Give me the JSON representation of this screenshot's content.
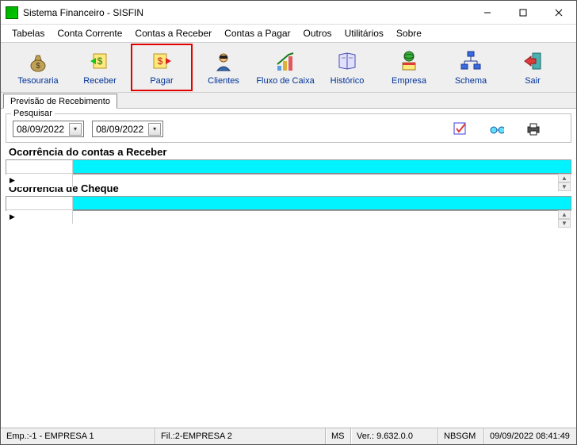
{
  "window": {
    "title": "Sistema Financeiro - SISFIN"
  },
  "menu": [
    "Tabelas",
    "Conta Corrente",
    "Contas a Receber",
    "Contas a Pagar",
    "Outros",
    "Utilitários",
    "Sobre"
  ],
  "toolbar": [
    {
      "label": "Tesouraria",
      "icon": "money-bag-icon",
      "highlight": false
    },
    {
      "label": "Receber",
      "icon": "receive-icon",
      "highlight": false
    },
    {
      "label": "Pagar",
      "icon": "pay-icon",
      "highlight": true
    },
    {
      "label": "Clientes",
      "icon": "client-icon",
      "highlight": false
    },
    {
      "label": "Fluxo de Caixa",
      "icon": "cashflow-icon",
      "highlight": false
    },
    {
      "label": "Histórico",
      "icon": "history-icon",
      "highlight": false
    },
    {
      "label": "Empresa",
      "icon": "company-icon",
      "highlight": false
    },
    {
      "label": "Schema",
      "icon": "schema-icon",
      "highlight": false
    },
    {
      "label": "Sair",
      "icon": "exit-icon",
      "highlight": false
    }
  ],
  "tab": {
    "label": "Previsão de Recebimento"
  },
  "filter": {
    "legend": "Pesquisar",
    "date_from": "08/09/2022",
    "date_to": "08/09/2022"
  },
  "sections": {
    "receivables": {
      "title": "Ocorrência do contas a Receber"
    },
    "cheque": {
      "title": "Ocorrência de Cheque"
    }
  },
  "status": {
    "emp": "Emp.:-1 - EMPRESA 1",
    "fil": "Fil.:2-EMPRESA 2",
    "ms": "MS",
    "ver": "Ver.: 9.632.0.0",
    "user": "NBSGM",
    "time": "09/09/2022 08:41:49"
  }
}
